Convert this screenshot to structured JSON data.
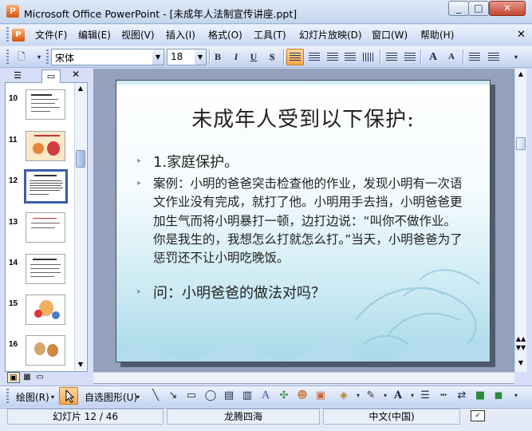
{
  "window": {
    "title": "Microsoft Office PowerPoint - [未成年人法制宣传讲座.ppt]",
    "app_icon_letter": "P"
  },
  "menu": {
    "items": [
      "文件(F)",
      "编辑(E)",
      "视图(V)",
      "插入(I)",
      "格式(O)",
      "工具(T)",
      "幻灯片放映(D)",
      "窗口(W)",
      "帮助(H)"
    ]
  },
  "formatting": {
    "font_name": "宋体",
    "font_size": "18",
    "bold": "B",
    "italic": "I",
    "underline": "U",
    "shadow": "S",
    "grow_font": "A",
    "shrink_font": "A"
  },
  "slide_panel": {
    "thumbnails": [
      {
        "number": "10"
      },
      {
        "number": "11"
      },
      {
        "number": "12",
        "selected": true
      },
      {
        "number": "13"
      },
      {
        "number": "14"
      },
      {
        "number": "15"
      },
      {
        "number": "16"
      }
    ]
  },
  "slide": {
    "title": "未成年人受到以下保护:",
    "bullets": [
      "1.家庭保护。",
      "案例：小明的爸爸突击检查他的作业，发现小明有一次语文作业没有完成，就打了他。小明用手去挡，小明爸爸更加生气而将小明暴打一顿，边打边说：“叫你不做作业。你是我生的，我想怎么打就怎么打。”当天，小明爸爸为了惩罚还不让小明吃晚饭。",
      "问：小明爸爸的做法对吗？"
    ]
  },
  "drawing_toolbar": {
    "draw_label": "绘图(R)",
    "autoshapes_label": "自选图形(U)"
  },
  "status": {
    "slide_indicator": "幻灯片 12 / 46",
    "design_name": "龙腾四海",
    "language": "中文(中国)"
  },
  "colors": {
    "accent_selected": "#3a5ea8",
    "toolbar_active": "#f6a44a",
    "slide_background_top": "#ffffff",
    "slide_background_bottom": "#a8d8e8"
  }
}
